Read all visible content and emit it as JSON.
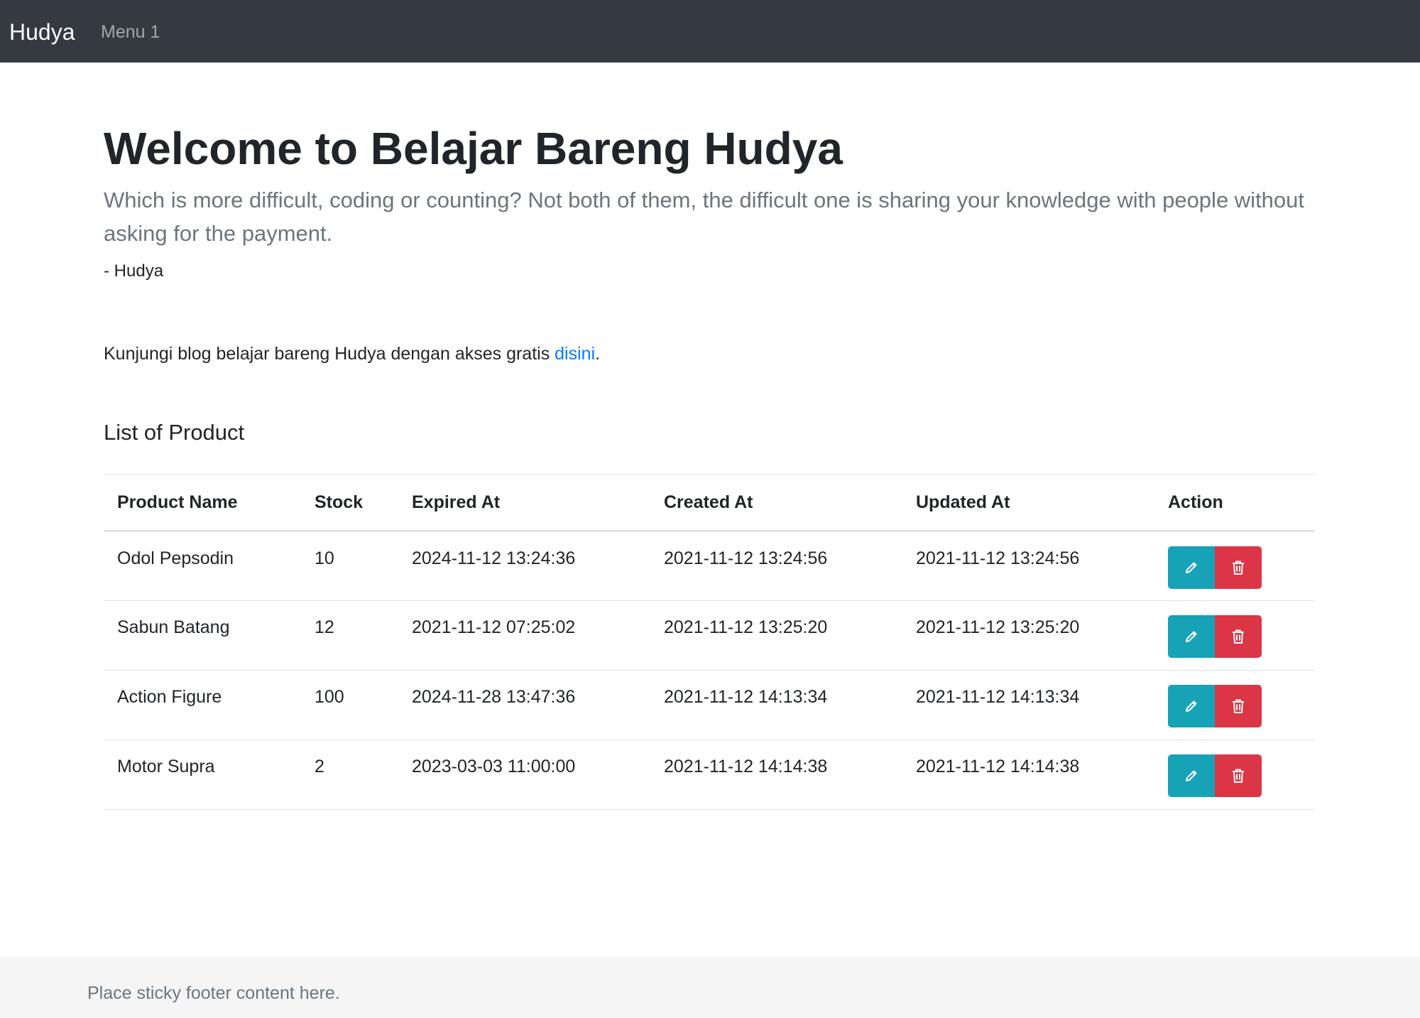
{
  "navbar": {
    "brand": "Hudya",
    "menu": [
      "Menu 1"
    ]
  },
  "jumbotron": {
    "title": "Welcome to Belajar Bareng Hudya",
    "lead": "Which is more difficult, coding or counting? Not both of them, the difficult one is sharing your knowledge with people without asking for the payment.",
    "author": "- Hudya"
  },
  "blog": {
    "text": "Kunjungi blog belajar bareng Hudya dengan akses gratis ",
    "link_label": "disini",
    "suffix": "."
  },
  "products": {
    "title": "List of Product",
    "columns": [
      "Product Name",
      "Stock",
      "Expired At",
      "Created At",
      "Updated At",
      "Action"
    ],
    "rows": [
      {
        "name": "Odol Pepsodin",
        "stock": "10",
        "expired_at": "2024-11-12 13:24:36",
        "created_at": "2021-11-12 13:24:56",
        "updated_at": "2021-11-12 13:24:56"
      },
      {
        "name": "Sabun Batang",
        "stock": "12",
        "expired_at": "2021-11-12 07:25:02",
        "created_at": "2021-11-12 13:25:20",
        "updated_at": "2021-11-12 13:25:20"
      },
      {
        "name": "Action Figure",
        "stock": "100",
        "expired_at": "2024-11-28 13:47:36",
        "created_at": "2021-11-12 14:13:34",
        "updated_at": "2021-11-12 14:13:34"
      },
      {
        "name": "Motor Supra",
        "stock": "2",
        "expired_at": "2023-03-03 11:00:00",
        "created_at": "2021-11-12 14:14:38",
        "updated_at": "2021-11-12 14:14:38"
      }
    ],
    "actions": {
      "edit_icon": "pencil-icon",
      "delete_icon": "trash-icon"
    }
  },
  "footer": {
    "text": "Place sticky footer content here."
  },
  "colors": {
    "navbar_bg": "#343a40",
    "edit_button": "#17a2b8",
    "delete_button": "#dc3545",
    "link": "#007bff",
    "footer_bg": "#f5f5f5"
  }
}
